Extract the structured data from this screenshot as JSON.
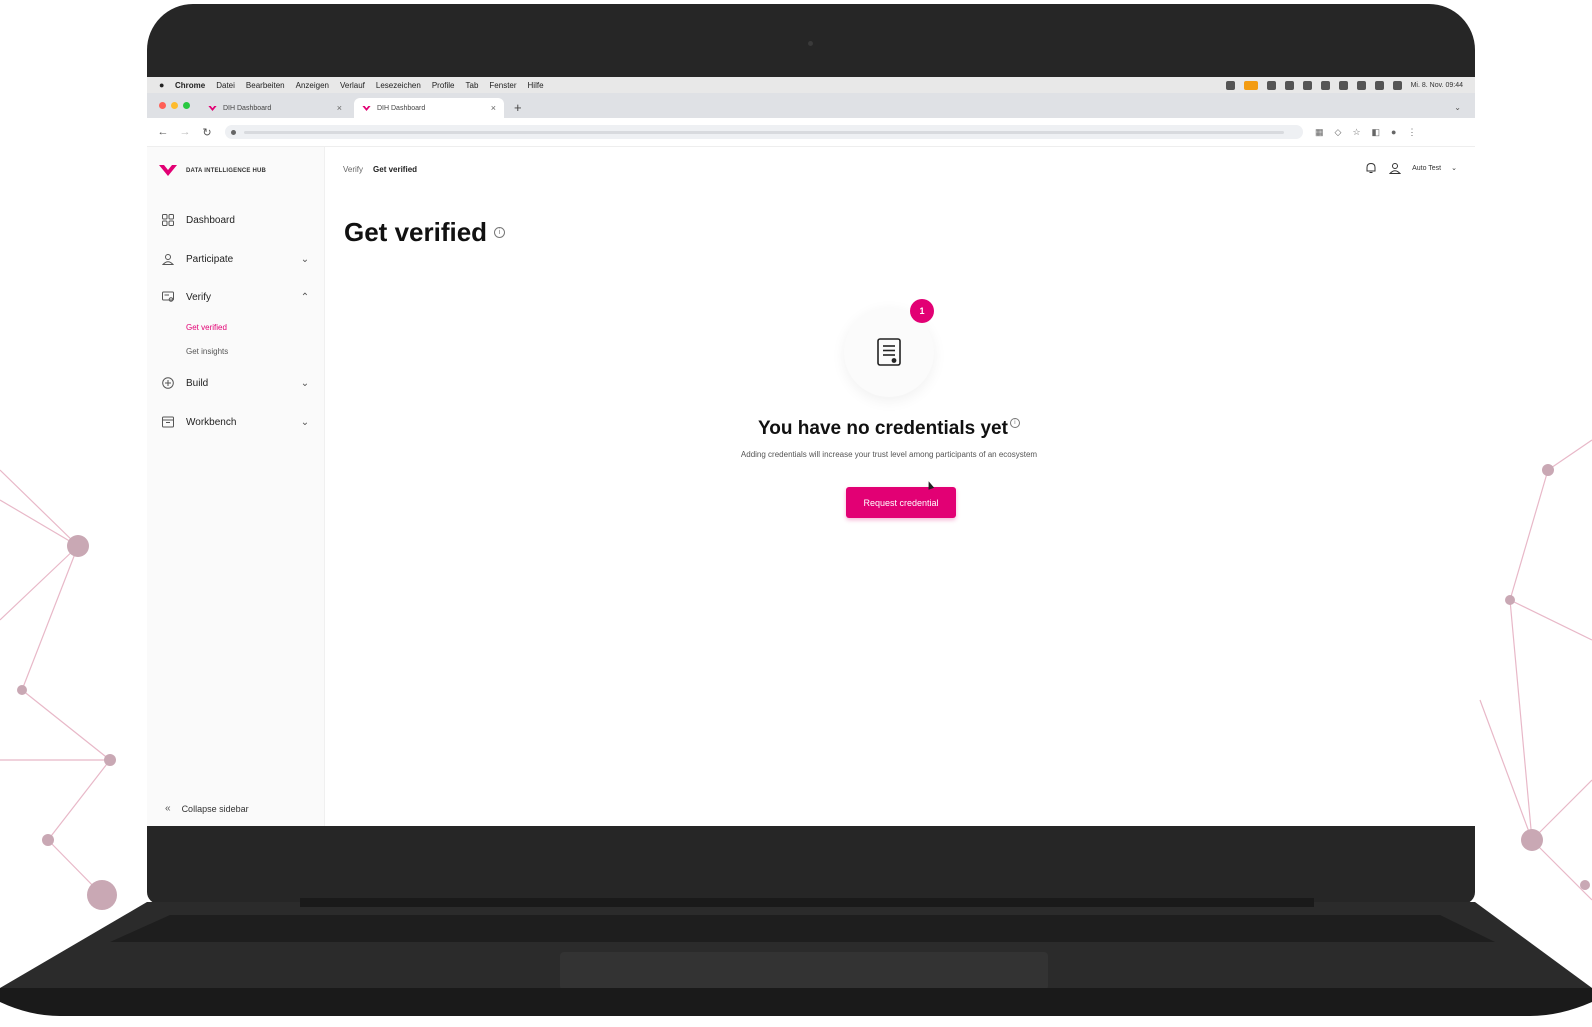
{
  "colors": {
    "brand": "#e20074",
    "laptop_frame": "#262626",
    "background_net": "#e8b8c8"
  },
  "menubar": {
    "app": "Chrome",
    "items": [
      "Datei",
      "Bearbeiten",
      "Anzeigen",
      "Verlauf",
      "Lesezeichen",
      "Profile",
      "Tab",
      "Fenster",
      "Hilfe"
    ],
    "clock": "Mi. 8. Nov. 09:44"
  },
  "tabs": [
    {
      "label": "DIH Dashboard",
      "close": "×"
    },
    {
      "label": "DIH Dashboard",
      "close": "×"
    }
  ],
  "newtab": "+",
  "app": {
    "brand": "DATA INTELLIGENCE HUB",
    "breadcrumb": {
      "parent": "Verify",
      "current": "Get verified"
    },
    "user": {
      "name": "Auto Test",
      "caret": "⌄"
    },
    "nav": {
      "dashboard": "Dashboard",
      "participate": "Participate",
      "verify": "Verify",
      "verify_sub": [
        "Get verified",
        "Get insights"
      ],
      "build": "Build",
      "workbench": "Workbench",
      "collapse": "Collapse sidebar"
    },
    "page_title": "Get verified",
    "info_glyph": "i",
    "badge_count": "1",
    "empty_state": {
      "title": "You have no credentials yet",
      "subtitle": "Adding credentials will increase your trust level among participants of an ecosystem",
      "button": "Request credential"
    }
  }
}
